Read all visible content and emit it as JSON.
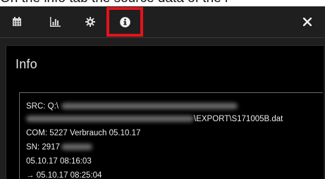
{
  "caption": {
    "text": "On the info tab the source data of the i"
  },
  "toolbar": {
    "buttons": [
      {
        "icon": "calendar-icon",
        "active": false
      },
      {
        "icon": "bar-chart-icon",
        "active": false
      },
      {
        "icon": "gear-icon",
        "active": false
      },
      {
        "icon": "info-icon",
        "active": true
      }
    ],
    "close_icon": "close-icon",
    "highlight_color": "#e5131b"
  },
  "info": {
    "title": "Info",
    "src_label": "SRC: Q:\\",
    "src_suffix": "\\EXPORT\\S171005B.dat",
    "com_line": "COM: 5227 Verbrauch 05.10.17",
    "sn_label": "SN: 2917",
    "start_time": "05.10.17 08:16:03",
    "end_arrow": "→",
    "end_time": "05.10.17 08:25:04"
  }
}
